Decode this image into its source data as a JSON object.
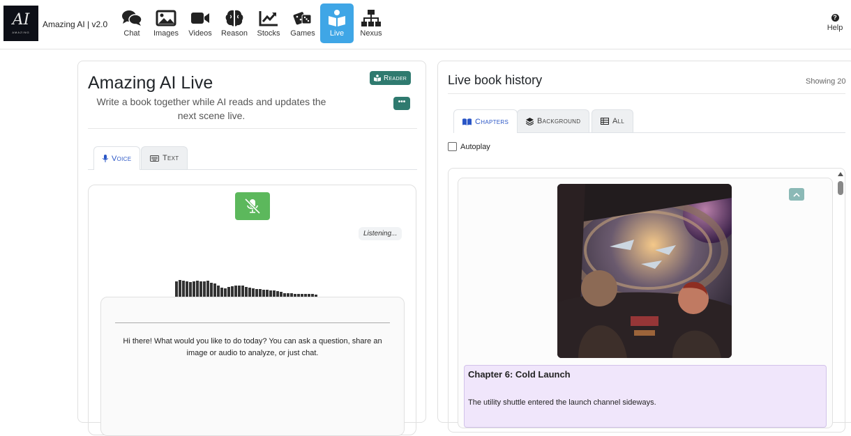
{
  "app": {
    "logo_text": "AI",
    "logo_subtext": "AMAZING",
    "brand": "Amazing AI | v2.0"
  },
  "nav": {
    "items": [
      {
        "label": "Chat",
        "icon": "chat-icon",
        "active": false
      },
      {
        "label": "Images",
        "icon": "image-icon",
        "active": false
      },
      {
        "label": "Videos",
        "icon": "video-icon",
        "active": false
      },
      {
        "label": "Reason",
        "icon": "brain-icon",
        "active": false
      },
      {
        "label": "Stocks",
        "icon": "chart-line-icon",
        "active": false
      },
      {
        "label": "Games",
        "icon": "dice-icon",
        "active": false
      },
      {
        "label": "Live",
        "icon": "book-reader-icon",
        "active": true
      },
      {
        "label": "Nexus",
        "icon": "network-icon",
        "active": false
      }
    ],
    "help_label": "Help",
    "active_color": "#3fa6e6"
  },
  "left": {
    "title": "Amazing AI Live",
    "subtitle": "Write a book together while AI reads and updates the next scene live.",
    "reader_label": "Reader",
    "more_label": "•••",
    "tabs": [
      {
        "label": "Voice",
        "icon": "microphone-icon",
        "active": true
      },
      {
        "label": "Text",
        "icon": "keyboard-icon",
        "active": false
      }
    ],
    "status": "Listening...",
    "greeting": "Hi there! What would you like to do today? You can ask a question, share an image or audio to analyze, or just chat.",
    "accent": "#2f7a6f",
    "mic_color": "#5cb85c"
  },
  "right": {
    "title": "Live book history",
    "count": "Showing 20",
    "tabs": [
      {
        "label": "Chapters",
        "icon": "book-open-icon",
        "active": true
      },
      {
        "label": "Background",
        "icon": "layers-icon",
        "active": false
      },
      {
        "label": "All",
        "icon": "table-icon",
        "active": false
      }
    ],
    "autoplay_label": "Autoplay",
    "autoplay_checked": false,
    "entry": {
      "chapter_title": "Chapter 6: Cold Launch",
      "chapter_text": "The utility shuttle entered the launch channel sideways.",
      "highlight_color": "#f0e6fb"
    }
  }
}
